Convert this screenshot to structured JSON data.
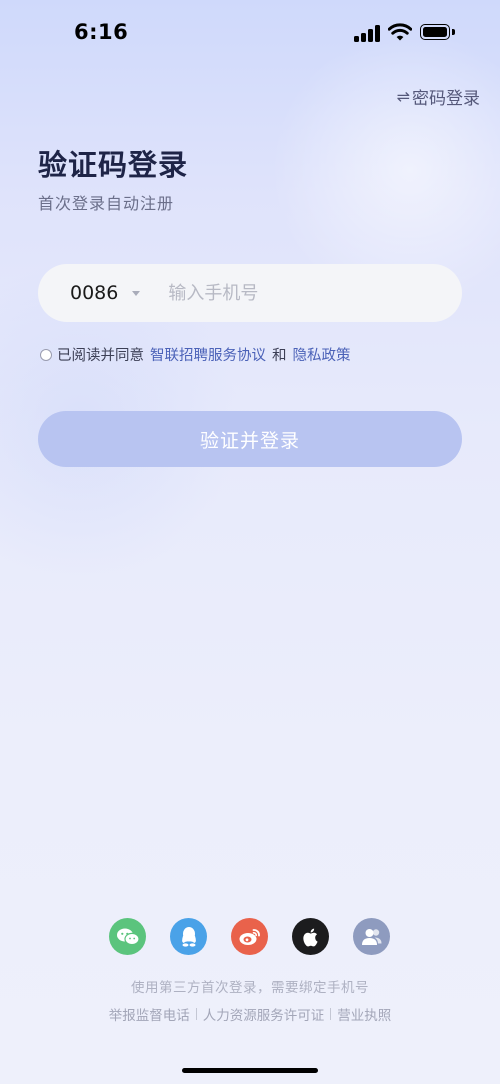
{
  "status_bar": {
    "time": "6:16"
  },
  "header": {
    "switch_label": "密码登录"
  },
  "main": {
    "title": "验证码登录",
    "subtitle": "首次登录自动注册",
    "country_code": "0086",
    "phone_placeholder": "输入手机号",
    "agreement": {
      "prefix": "已阅读并同意",
      "terms_link": "智联招聘服务协议",
      "and": "和",
      "privacy_link": "隐私政策"
    },
    "login_button": "验证并登录"
  },
  "third_party": {
    "icons": [
      "wechat-icon",
      "qq-icon",
      "weibo-icon",
      "apple-icon",
      "contacts-icon"
    ],
    "colors": {
      "wechat": "#5bc47d",
      "qq": "#4aa2e8",
      "weibo": "#e9624b",
      "apple": "#1c1c1e",
      "contacts": "#8e9bbf"
    },
    "note": "使用第三方首次登录，需要绑定手机号"
  },
  "footer": {
    "links": [
      "举报监督电话",
      "人力资源服务许可证",
      "营业执照"
    ]
  }
}
